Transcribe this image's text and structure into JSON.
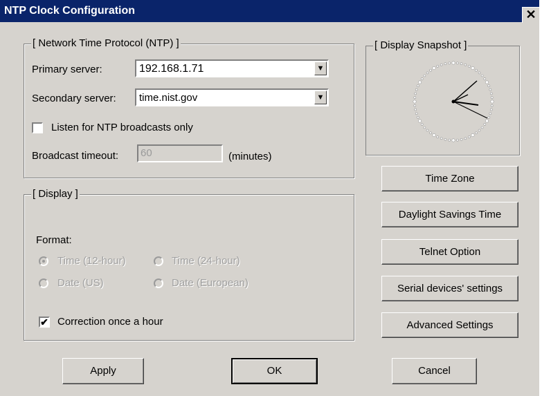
{
  "window": {
    "title": "NTP Clock Configuration",
    "close_glyph": "✕"
  },
  "ntp": {
    "legend": "[ Network Time Protocol (NTP) ]",
    "primary_label": "Primary server:",
    "primary_value": "192.168.1.71",
    "secondary_label": "Secondary server:",
    "secondary_value": "time.nist.gov",
    "broadcast_only_label": "Listen for NTP broadcasts only",
    "broadcast_only_checked": false,
    "timeout_label": "Broadcast timeout:",
    "timeout_value": "60",
    "timeout_unit": "(minutes)"
  },
  "display": {
    "legend": "[ Display ]",
    "format_label": "Format:",
    "options": {
      "time12": "Time (12-hour)",
      "time24": "Time (24-hour)",
      "date_us": "Date (US)",
      "date_eu": "Date (European)"
    },
    "selected": "time12",
    "correction_label": "Correction once a hour",
    "correction_checked": true,
    "check_glyph": "✔"
  },
  "snapshot": {
    "legend": "[ Display Snapshot ]"
  },
  "side_buttons": {
    "time_zone": "Time Zone",
    "dst": "Daylight Savings Time",
    "telnet": "Telnet Option",
    "serial": "Serial devices' settings",
    "advanced": "Advanced Settings"
  },
  "footer": {
    "apply": "Apply",
    "ok": "OK",
    "cancel": "Cancel"
  },
  "icons": {
    "dropdown": "▼"
  }
}
